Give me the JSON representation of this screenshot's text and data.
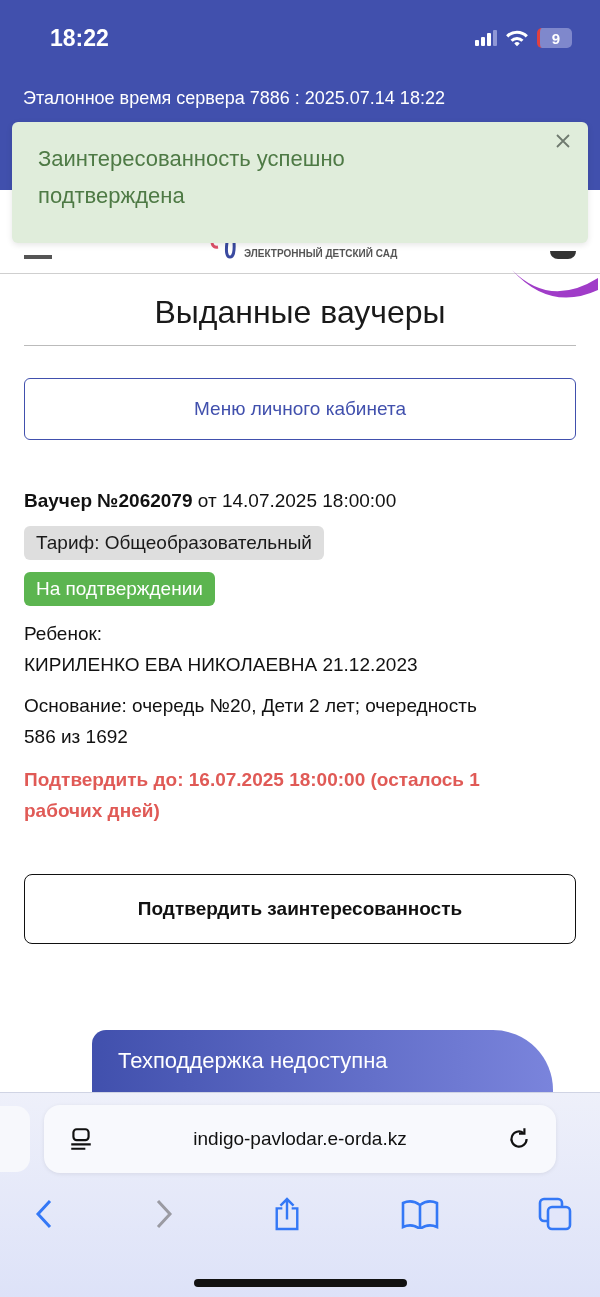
{
  "status_bar": {
    "time": "18:22",
    "battery": "9"
  },
  "server_time": "Эталонное время сервера 7886 : 2025.07.14 18:22",
  "toast": {
    "message": "Заинтересованность успешно подтверждена"
  },
  "logo": {
    "caption": "ЭЛЕКТРОННЫЙ ДЕТСКИЙ САД"
  },
  "title": "Выданные ваучеры",
  "menu_button": "Меню личного кабинета",
  "voucher": {
    "heading": "**Ваучер №2062079** от 14.07.2025 18:00:00",
    "tariff": "Тариф: Общеобразовательный",
    "status": {
      "label": "На подтверждении",
      "kind": "pending"
    },
    "child_label": "Ребенок:",
    "child": "КИРИЛЕНКО ЕВА НИКОЛАЕВНА 21.12.2023",
    "basis": "Основание: очередь №20, Дети 2 лет; очередность 586 из 1692",
    "deadline": "Подтвердить до: 16.07.2025 18:00:00 (осталось 1 рабочих дней)"
  },
  "confirm_button": "Подтвердить заинтересованность",
  "support_tab": "Техподдержка недоступна",
  "browser": {
    "url": "indigo-pavlodar.e-orda.kz",
    "back_disabled": false,
    "forward_disabled": true
  }
}
